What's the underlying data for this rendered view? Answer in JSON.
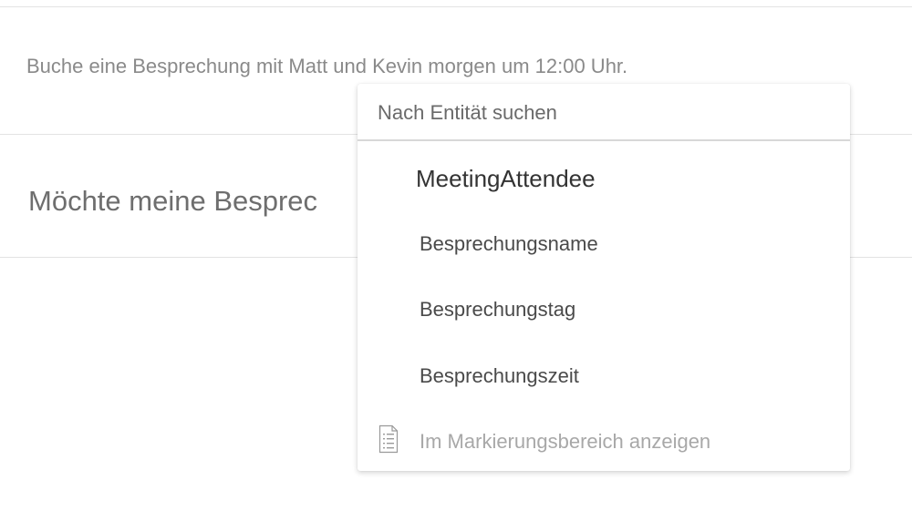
{
  "utterances": [
    "Buche eine Besprechung mit Matt und Kevin morgen um 12:00 Uhr.",
    "Möchte meine Besprec"
  ],
  "entity_dropdown": {
    "search_placeholder": "Nach Entität suchen",
    "items": [
      {
        "label": "MeetingAttendee"
      },
      {
        "label": "Besprechungsname"
      },
      {
        "label": "Besprechungstag"
      },
      {
        "label": "Besprechungszeit"
      }
    ],
    "footer": {
      "label": "Im Markierungsbereich anzeigen",
      "icon": "document-list-icon"
    }
  },
  "colors": {
    "utterance_text": "#8a8a8a",
    "item_text": "#4a4a4a",
    "muted_text": "#a8a8a8",
    "divider": "#e3e3e3"
  }
}
